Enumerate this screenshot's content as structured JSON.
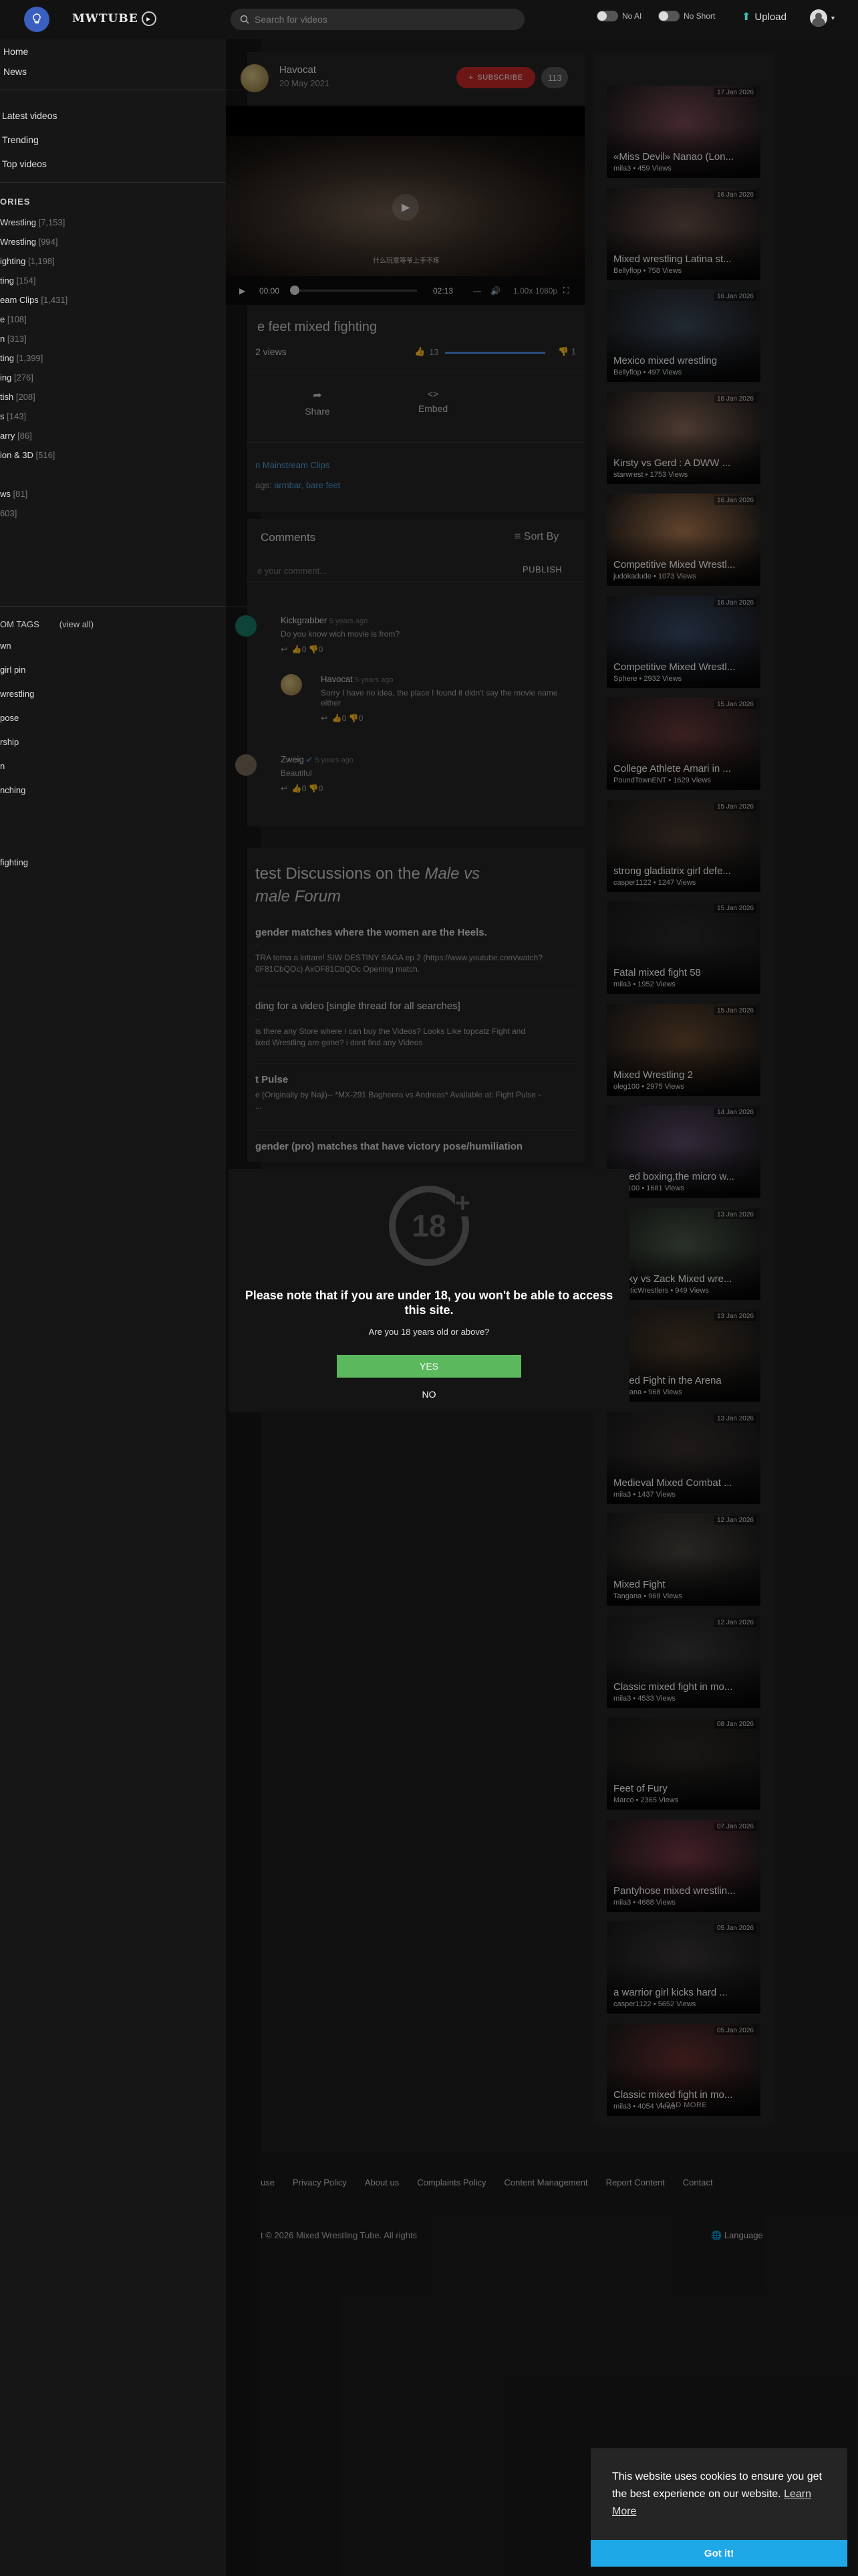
{
  "header": {
    "logo": "MWTUBE",
    "search_placeholder": "Search for videos",
    "toggle_ai": "No AI",
    "toggle_short": "No Short",
    "upload": "Upload"
  },
  "sidebar": {
    "nav": [
      "Home",
      "News"
    ],
    "lists": [
      "Latest videos",
      "Trending",
      "Top videos"
    ],
    "categories_heading": "ORIES",
    "categories": [
      {
        "label": "Wrestling",
        "count": "[7,153]"
      },
      {
        "label": " Wrestling",
        "count": "[994]"
      },
      {
        "label": "ighting",
        "count": "[1,198]"
      },
      {
        "label": "ting",
        "count": "[154]"
      },
      {
        "label": "eam Clips",
        "count": "[1,431]"
      },
      {
        "label": "e",
        "count": "[108]"
      },
      {
        "label": "n",
        "count": "[313]"
      },
      {
        "label": "ting",
        "count": "[1,399]"
      },
      {
        "label": "ing",
        "count": "[276]"
      },
      {
        "label": "tish",
        "count": "[208]"
      },
      {
        "label": "s",
        "count": "[143]"
      },
      {
        "label": "arry",
        "count": "[86]"
      },
      {
        "label": "ion & 3D",
        "count": "[516]"
      },
      {
        "label": "",
        "count": ""
      },
      {
        "label": "ws",
        "count": "[81]"
      },
      {
        "label": "",
        "count": "603]"
      }
    ],
    "tags_heading": "OM TAGS",
    "view_all": "(view all)",
    "tags": [
      "wn",
      "girl pin",
      "wrestling",
      "pose",
      "rship",
      "n",
      "nching",
      "",
      "",
      "fighting"
    ]
  },
  "channel": {
    "name": "Havocat",
    "date": "20 May 2021",
    "subscribe": "SUBSCRIBE",
    "subscribers": "113"
  },
  "player": {
    "subtitle": "什么玩意等爷上手不疼",
    "time_current": "00:00",
    "time_total": "02:13",
    "rate": "1.00x",
    "quality": "1080p"
  },
  "video": {
    "title": "e feet mixed fighting",
    "views": "2 views",
    "likes": "13",
    "dislikes": "1",
    "share": "Share",
    "embed": "Embed",
    "category_prefix": "n",
    "category_link": "Mainstream Clips",
    "tags_label": "ags:",
    "tags": [
      "armbar",
      "bare feet"
    ]
  },
  "comments": {
    "heading": "Comments",
    "sort": "Sort By",
    "input_placeholder": "e your comment...",
    "publish": "PUBLISH",
    "items": [
      {
        "user": "Kickgrabber",
        "when": "5 years ago",
        "text": "Do you know wich movie is from?",
        "likes": "0",
        "dislikes": "0"
      },
      {
        "user": "Havocat",
        "when": "5 years ago",
        "text": "Sorry I have no idea, the place I found it didn't say the movie name either",
        "likes": "0",
        "dislikes": "0"
      },
      {
        "user": "Zweig",
        "when": "5 years ago",
        "text": "Beautiful",
        "likes": "0",
        "dislikes": "0"
      }
    ]
  },
  "forum": {
    "heading_1": "test Discussions on the ",
    "heading_italic": "Male vs",
    "heading_2": "male Forum",
    "threads": [
      {
        "title": "gender matches where the women are the Heels.",
        "meta": "...",
        "desc": "TRA torna a lottare! SIW DESTINY SAGA ep 2 (https://www.youtube.com/watch?\n0F81CbQOc) AxOF81CbQOc Opening match."
      },
      {
        "title": "ding for a video [single thread for all searches]",
        "meta": "...",
        "desc": "is there any Store where i can buy the Videos? Looks Like topcatz Fight and\nixed Wrestling are gone? i dont find any Videos"
      },
      {
        "title": "t Pulse",
        "meta": "",
        "desc": "e (Originally by Naji)-- *MX-291 Bagheera vs Andreas* Available at: Fight Pulse -\n..."
      },
      {
        "title": "gender (pro) matches that have victory pose/humiliation",
        "meta": "",
        "desc": ""
      }
    ]
  },
  "related": [
    {
      "title": "«Miss Devil» Nanao (Lon...",
      "meta": "mila3 • 459 Views",
      "date": "17 Jan 2026",
      "color": "#7a4a55"
    },
    {
      "title": "Mixed wrestling Latina st...",
      "meta": "Bellyflop • 758 Views",
      "date": "16 Jan 2026",
      "color": "#6a5048"
    },
    {
      "title": "Mexico mixed wrestling",
      "meta": "Bellyflop • 497 Views",
      "date": "16 Jan 2026",
      "color": "#3c4a5a"
    },
    {
      "title": "Kirsty vs Gerd : A DWW ...",
      "meta": "starwrest • 1753 Views",
      "date": "16 Jan 2026",
      "color": "#8a6a58"
    },
    {
      "title": "Competitive Mixed Wrestl...",
      "meta": "judokadude • 1073 Views",
      "date": "16 Jan 2026",
      "color": "#b07a50"
    },
    {
      "title": "Competitive Mixed Wrestl...",
      "meta": "Sphere • 2932 Views",
      "date": "16 Jan 2026",
      "color": "#3a4c6a"
    },
    {
      "title": "College Athlete Amari in ...",
      "meta": "PoundTownENT • 1629 Views",
      "date": "15 Jan 2026",
      "color": "#6a3a3a"
    },
    {
      "title": "strong gladiatrix girl defe...",
      "meta": "casper1122 • 1247 Views",
      "date": "15 Jan 2026",
      "color": "#4a3a30"
    },
    {
      "title": "Fatal mixed fight 58",
      "meta": "mila3 • 1952 Views",
      "date": "15 Jan 2026",
      "color": "#2a2a2a"
    },
    {
      "title": "Mixed Wrestling 2",
      "meta": "oleg100 • 2975 Views",
      "date": "15 Jan 2026",
      "color": "#6a4a30"
    },
    {
      "title": "mixed boxing,the micro w...",
      "meta": "oleg100 • 1681 Views",
      "date": "14 Jan 2026",
      "color": "#5a4a68"
    },
    {
      "title": "Nicky vs Zack Mixed wre...",
      "meta": "AthleticWrestlers • 949 Views",
      "date": "13 Jan 2026",
      "color": "#4a5a4a"
    },
    {
      "title": "Mixed Fight in the Arena",
      "meta": "Tangana • 968 Views",
      "date": "13 Jan 2026",
      "color": "#4a3a2a"
    },
    {
      "title": "Medieval Mixed Combat ...",
      "meta": "mila3 • 1437 Views",
      "date": "13 Jan 2026",
      "color": "#3a3030"
    },
    {
      "title": "Mixed Fight",
      "meta": "Tangana • 969 Views",
      "date": "12 Jan 2026",
      "color": "#4a4540"
    },
    {
      "title": "Classic mixed fight in mo...",
      "meta": "mila3 • 4533 Views",
      "date": "12 Jan 2026",
      "color": "#3a3a3a"
    },
    {
      "title": "Feet of Fury",
      "meta": "Marco • 2365 Views",
      "date": "08 Jan 2026",
      "color": "#2e2a26"
    },
    {
      "title": "Pantyhose mixed wrestlin...",
      "meta": "mila3 • 4688 Views",
      "date": "07 Jan 2026",
      "color": "#7a3a48"
    },
    {
      "title": "a warrior girl kicks hard ...",
      "meta": "casper1122 • 5652 Views",
      "date": "05 Jan 2026",
      "color": "#3a3636"
    },
    {
      "title": "Classic mixed fight in mo...",
      "meta": "mila3 • 4054 Views",
      "date": "05 Jan 2026",
      "color": "#6a3030"
    }
  ],
  "load_more": "LOAD MORE",
  "footer": {
    "links": [
      "use",
      "Privacy Policy",
      "About us",
      "Complaints Policy",
      "Content Management",
      "Report Content",
      "Contact"
    ],
    "copyright": "t © 2026 Mixed Wrestling Tube. All rights",
    "language": "Language"
  },
  "age_gate": {
    "badge": "18",
    "message": "Please note that if you are under 18, you won't be able to access this site.",
    "question": "Are you 18 years old or above?",
    "yes": "YES",
    "no": "NO"
  },
  "cookie": {
    "text": "This website uses cookies to ensure you get the best experience on our website.",
    "learn_more": "Learn More",
    "accept": "Got it!"
  }
}
